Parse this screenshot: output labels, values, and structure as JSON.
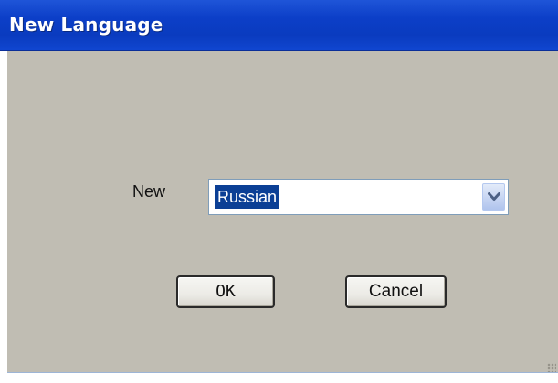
{
  "window": {
    "title": "New Language"
  },
  "form": {
    "new_label": "New",
    "language_select": {
      "selected_value": "Russian",
      "arrow_icon": "chevron-down-icon"
    }
  },
  "buttons": {
    "ok_label": "OK",
    "cancel_label": "Cancel"
  },
  "colors": {
    "titlebar": "#0c3fc8",
    "client_background": "#c0bdb3",
    "selection_highlight": "#0b3f95"
  }
}
